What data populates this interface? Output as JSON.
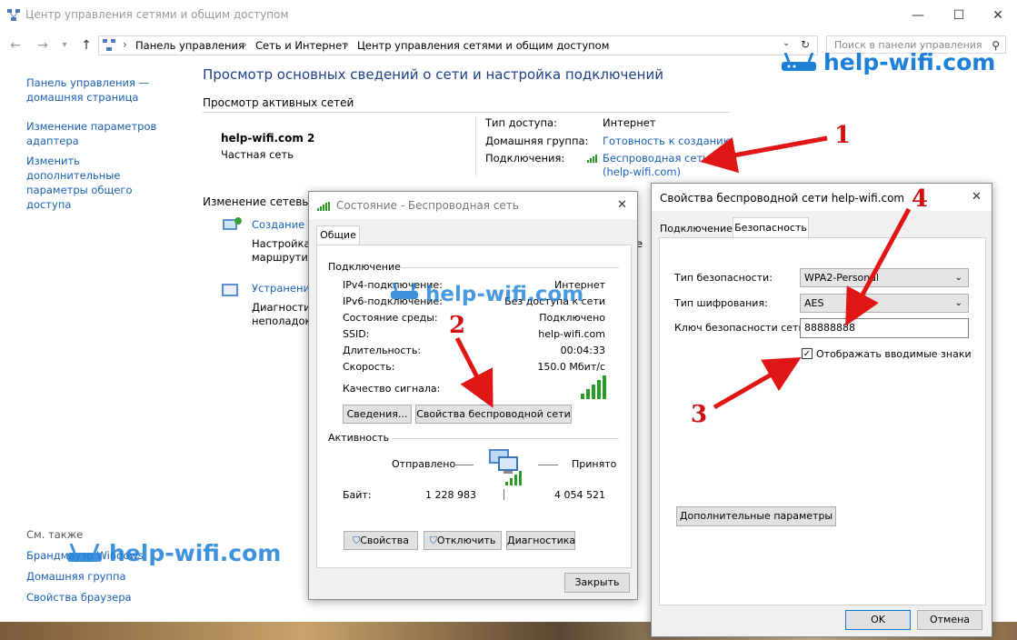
{
  "window": {
    "title": "Центр управления сетями и общим доступом",
    "minimize": "—",
    "maximize": "☐",
    "close": "✕"
  },
  "address": {
    "back": "←",
    "forward": "→",
    "up": "↑",
    "crumbs": [
      "Панель управления",
      "Сеть и Интернет",
      "Центр управления сетями и общим доступом"
    ],
    "sep": "›",
    "search_placeholder": "Поиск в панели управления"
  },
  "sidebar": {
    "items": [
      {
        "label": "Панель управления — домашняя страница"
      },
      {
        "label": "Изменение параметров адаптера"
      },
      {
        "label": "Изменить дополнительные параметры общего доступа"
      }
    ],
    "see_also_title": "См. также",
    "see_also": [
      {
        "label": "Брандмауэр Windows"
      },
      {
        "label": "Домашняя группа"
      },
      {
        "label": "Свойства браузера"
      }
    ]
  },
  "main": {
    "heading": "Просмотр основных сведений о сети и настройка подключений",
    "active_title": "Просмотр активных сетей",
    "network_name": "help-wifi.com  2",
    "network_type": "Частная сеть",
    "access_label": "Тип доступа:",
    "access_value": "Интернет",
    "homegroup_label": "Домашняя группа:",
    "homegroup_value": "Готовность к созданию",
    "connections_label": "Подключения:",
    "connections_value": "Беспроводная сеть",
    "connections_value2": "(help-wifi.com)",
    "change_title": "Изменение сетевых п",
    "create_link": "Создание и",
    "create_desc1": "Настройка",
    "create_desc2": "маршрутиз",
    "troubleshoot_link": "Устранение",
    "troubleshoot_desc1": "Диагностик",
    "troubleshoot_desc2": "неполадок."
  },
  "status_dialog": {
    "title": "Состояние - Беспроводная сеть",
    "close": "✕",
    "tab": "Общие",
    "connection_group": "Подключение",
    "rows": [
      {
        "label": "IPv4-подключение:",
        "value": "Интернет"
      },
      {
        "label": "IPv6-подключение:",
        "value": "Без доступа к сети"
      },
      {
        "label": "Состояние среды:",
        "value": "Подключено"
      },
      {
        "label": "SSID:",
        "value": "help-wifi.com"
      },
      {
        "label": "Длительность:",
        "value": "00:04:33"
      },
      {
        "label": "Скорость:",
        "value": "150.0 Мбит/с"
      }
    ],
    "signal_label": "Качество сигнала:",
    "details_button": "Сведения...",
    "wireless_props_button": "Свойства беспроводной сети",
    "activity_group": "Активность",
    "sent_label": "Отправлено",
    "received_label": "Принято",
    "bytes_label": "Байт:",
    "bytes_sent": "1 228 983",
    "bytes_received": "4 054 521",
    "properties_button": "Свойства",
    "disable_button": "Отключить",
    "diagnose_button": "Диагностика",
    "close_button": "Закрыть"
  },
  "props_dialog": {
    "title": "Свойства беспроводной сети help-wifi.com",
    "close": "✕",
    "tab_connection": "Подключение",
    "tab_security": "Безопасность",
    "security_type_label": "Тип безопасности:",
    "security_type_value": "WPA2-Personal",
    "encryption_label": "Тип шифрования:",
    "encryption_value": "AES",
    "key_label": "Ключ безопасности сети",
    "key_value": "88888888",
    "show_chars_label": "Отображать вводимые знаки",
    "advanced_button": "Дополнительные параметры",
    "ok_button": "OK",
    "cancel_button": "Отмена"
  },
  "watermark": "help-wifi.com",
  "annotations": [
    "1",
    "2",
    "3",
    "4"
  ],
  "colors": {
    "accent": "#1a5fb4",
    "watermark": "#1d80d8",
    "arrow": "#e01515"
  }
}
